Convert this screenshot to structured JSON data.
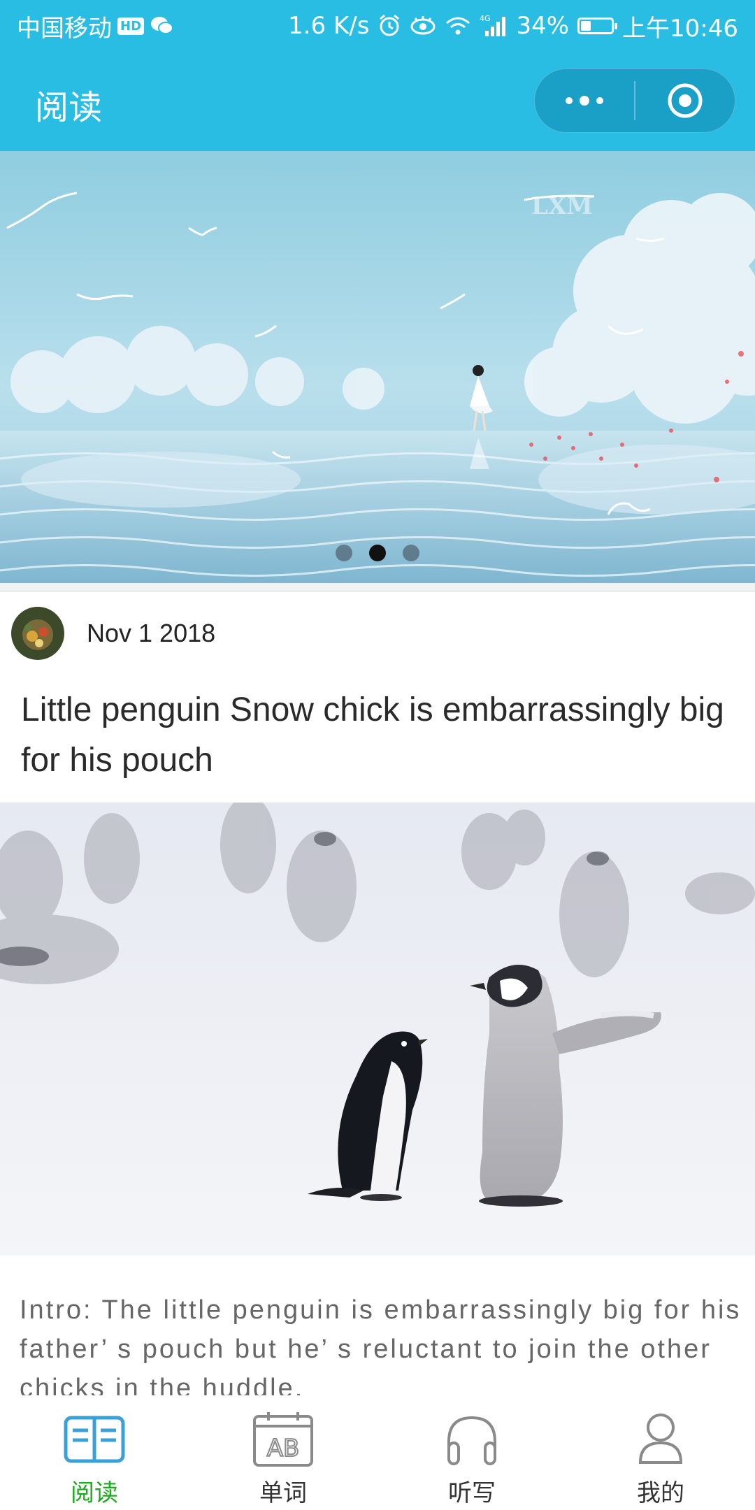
{
  "status_bar": {
    "carrier": "中国移动",
    "hd": "HD",
    "speed": "1.6 K/s",
    "network": "4G",
    "battery": "34%",
    "battery_level": 0.34,
    "time": "上午10:46",
    "icons": [
      "hd-icon",
      "wechat-icon",
      "alarm-icon",
      "eye-icon",
      "wifi-icon",
      "signal-icon",
      "battery-icon"
    ]
  },
  "nav": {
    "title": "阅读",
    "more_icon": "more-dots-icon",
    "close_icon": "target-close-icon",
    "bar_color": "#29bde4"
  },
  "banner": {
    "slides_count": 3,
    "active_index": 1,
    "watermark": "LXM"
  },
  "article": {
    "date": "Nov 1 2018",
    "title": "Little penguin Snow chick is embarrassingly big for his pouch",
    "intro": "Intro: The little penguin is embarrassingly big for his father’ s pouch but he’ s reluctant to join the other chicks in the huddle."
  },
  "tabs": [
    {
      "label": "阅读",
      "icon": "book-icon",
      "active": true
    },
    {
      "label": "单词",
      "icon": "ab-calendar-icon",
      "active": false
    },
    {
      "label": "听写",
      "icon": "headphones-icon",
      "active": false
    },
    {
      "label": "我的",
      "icon": "person-icon",
      "active": false
    }
  ],
  "colors": {
    "primary": "#29bde4",
    "tab_active": "#1aad19",
    "tab_icon_active": "#3aa0d8",
    "tab_inactive": "#8a8a8a"
  }
}
